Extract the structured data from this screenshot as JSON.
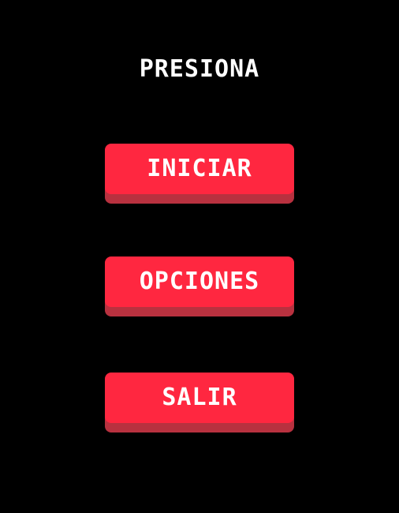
{
  "screen": {
    "title": "PRESIONA"
  },
  "menu": {
    "items": [
      {
        "id": "start",
        "label": "INICIAR"
      },
      {
        "id": "options",
        "label": "OPCIONES"
      },
      {
        "id": "exit",
        "label": "SALIR"
      }
    ]
  },
  "colors": {
    "background": "#000000",
    "button_face": "#ff2740",
    "button_shadow": "#b8313f",
    "text": "#ffffff"
  }
}
